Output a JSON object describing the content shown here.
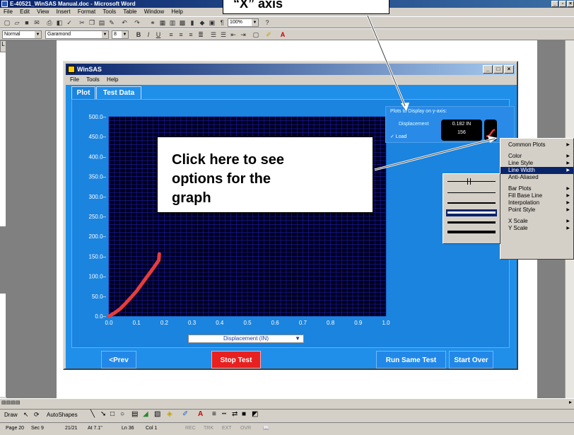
{
  "word": {
    "title": "E-40521_WinSAS Manual.doc - Microsoft Word",
    "menu": [
      "File",
      "Edit",
      "View",
      "Insert",
      "Format",
      "Tools",
      "Table",
      "Window",
      "Help"
    ],
    "zoom": "100%",
    "style": "Normal",
    "font": "Garamond",
    "font_size": "8"
  },
  "winsas": {
    "title": "WinSAS",
    "menu": [
      "File",
      "Tools",
      "Help"
    ],
    "tabs": [
      "Plot",
      "Test Data"
    ],
    "plots_header": "Plots to Display on y-axis:",
    "series": [
      {
        "label": "Displacement",
        "value": "0.182 IN",
        "checked": false
      },
      {
        "label": "✓ Load",
        "value": "156",
        "checked": true
      }
    ],
    "x_selector": "Displacement (IN)",
    "buttons": {
      "prev": "<Prev",
      "stop": "Stop Test",
      "run_same": "Run Same Test",
      "start_over": "Start Over"
    }
  },
  "chart_data": {
    "type": "line",
    "x_ticks": [
      "0.0",
      "0.1",
      "0.2",
      "0.3",
      "0.4",
      "0.5",
      "0.6",
      "0.7",
      "0.8",
      "0.9",
      "1.0"
    ],
    "y_ticks": [
      "0.0",
      "50.0",
      "100.0",
      "150.0",
      "200.0",
      "250.0",
      "300.0",
      "350.0",
      "400.0",
      "450.0",
      "500.0"
    ],
    "xlim": [
      0,
      1.0
    ],
    "ylim": [
      0,
      500
    ],
    "series": [
      {
        "name": "Load",
        "color": "#e83c3c",
        "points": [
          [
            0,
            0
          ],
          [
            0.02,
            8
          ],
          [
            0.04,
            18
          ],
          [
            0.06,
            32
          ],
          [
            0.08,
            47
          ],
          [
            0.1,
            63
          ],
          [
            0.12,
            82
          ],
          [
            0.14,
            101
          ],
          [
            0.16,
            120
          ],
          [
            0.18,
            140
          ],
          [
            0.182,
            156
          ]
        ]
      }
    ]
  },
  "context_menu": {
    "items": [
      "Common Plots",
      "Color",
      "Line Style",
      "Line Width",
      "Anti-Aliased",
      "Bar Plots",
      "Fill Base Line",
      "Interpolation",
      "Point Style",
      "X Scale",
      "Y Scale"
    ],
    "highlighted": "Line Width"
  },
  "callouts": {
    "main_lines": [
      "Click here to see",
      "options for the",
      "graph"
    ],
    "top": "“X” axis"
  },
  "status": {
    "page": "Page 20",
    "sec": "Sec 9",
    "pages": "21/21",
    "at": "At 7.1\"",
    "ln": "Ln 36",
    "col": "Col 1",
    "modes": [
      "REC",
      "TRK",
      "EXT",
      "OVR"
    ]
  },
  "drawbar": {
    "draw": "Draw",
    "autoshapes": "AutoShapes"
  }
}
